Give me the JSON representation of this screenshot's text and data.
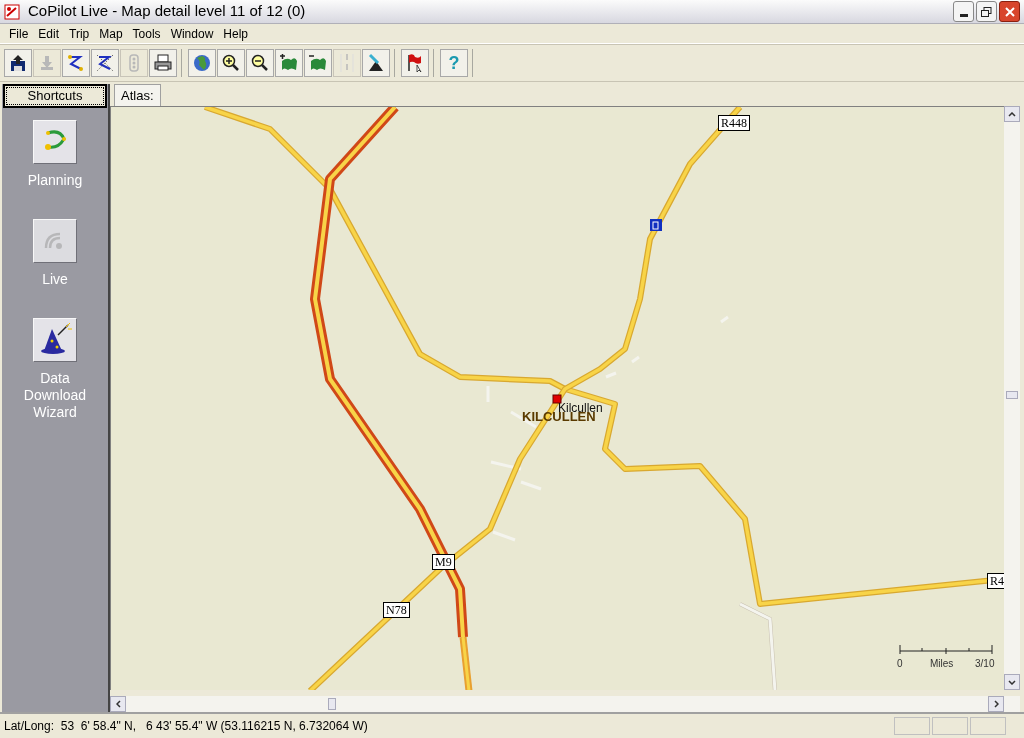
{
  "window": {
    "title": "CoPilot Live - Map detail level 11 of 12 (0)"
  },
  "menu": [
    "File",
    "Edit",
    "Trip",
    "Map",
    "Tools",
    "Window",
    "Help"
  ],
  "toolbar": [
    [
      {
        "disabled": false
      },
      {
        "disabled": true
      },
      {
        "disabled": false
      },
      {
        "disabled": false
      },
      {
        "disabled": true
      },
      {
        "disabled": false
      }
    ],
    [
      {
        "disabled": false
      },
      {
        "disabled": false
      },
      {
        "disabled": false
      },
      {
        "disabled": false
      },
      {
        "disabled": false
      },
      {
        "disabled": true
      },
      {
        "disabled": false
      }
    ],
    [
      {
        "disabled": false
      }
    ],
    [
      {
        "disabled": false,
        "glyph": "?"
      }
    ]
  ],
  "sidebar": {
    "header": "Shortcuts",
    "items": [
      {
        "label": "Planning",
        "disabled": false
      },
      {
        "label": "Live",
        "disabled": true
      },
      {
        "label": "Data Download Wizard",
        "disabled": false
      }
    ]
  },
  "tabs": [
    {
      "label": "Atlas:",
      "selected": true
    }
  ],
  "map": {
    "road_labels": [
      "R448",
      "M9",
      "N78",
      "R4"
    ],
    "town_label": "KILCULLEN",
    "place_label": "Kilcullen",
    "scale": {
      "start": "0",
      "unit": "Miles",
      "end": "3/10"
    }
  },
  "status_bar": {
    "text": "Lat/Long:  53  6' 58.4\" N,   6 43' 55.4\" W (53.116215 N, 6.732064 W)"
  }
}
